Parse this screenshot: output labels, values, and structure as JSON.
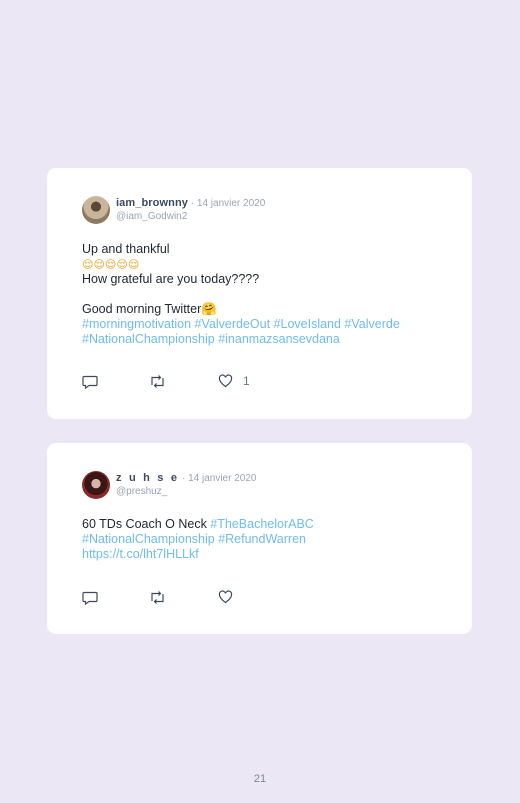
{
  "tweets": [
    {
      "username": "iam_brownny",
      "date": "· 14 janvier 2020",
      "handle": "@iam_Godwin2",
      "text_lines": [
        "Up and thankful",
        "😌😌😌😌😌",
        "How grateful are you today????",
        "",
        "Good morning Twitter🤗"
      ],
      "hashtag_lines": [
        "#morningmotivation #ValverdeOut #LoveIsland #Valverde",
        "#NationalChampionship #inanmazsansevdana"
      ],
      "like_count": "1",
      "icons": {
        "reply": "reply-icon",
        "retweet": "retweet-icon",
        "like": "heart-icon"
      }
    },
    {
      "username": "z u h s e",
      "date": "· 14 janvier 2020",
      "handle": "@preshuz_",
      "text_prefix": "60 TDs Coach O Neck ",
      "text_tag": "#TheBachelorABC",
      "hashtag_lines": [
        "#NationalChampionship #RefundWarren",
        "https://t.co/lht7lHLLkf"
      ],
      "like_count": "",
      "icons": {
        "reply": "reply-icon",
        "retweet": "retweet-icon",
        "like": "heart-icon"
      }
    }
  ],
  "page_number": "21",
  "colors": {
    "background": "#ebe7f5",
    "card": "#ffffff",
    "link": "#6fbde8",
    "meta": "#9aa4b2"
  }
}
